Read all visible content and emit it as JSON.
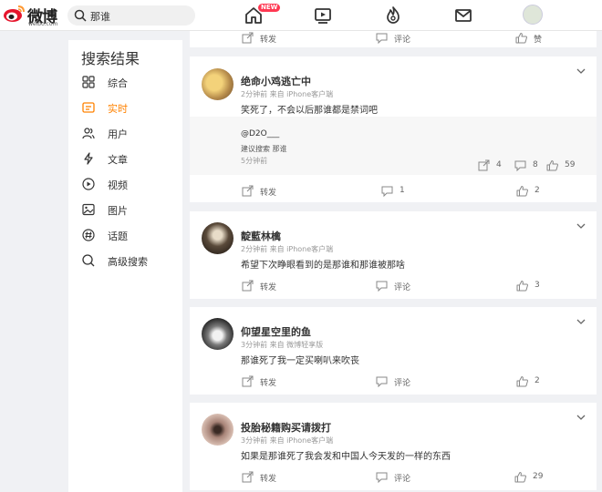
{
  "header": {
    "logo_word": "微博",
    "logo_url": "weibo.com",
    "search_query": "那谁",
    "new_badge": "NEW"
  },
  "sidebar": {
    "title": "搜索结果",
    "items": [
      {
        "label": "综合",
        "icon": "grid-icon"
      },
      {
        "label": "实时",
        "icon": "realtime-icon",
        "active": true
      },
      {
        "label": "用户",
        "icon": "users-icon"
      },
      {
        "label": "文章",
        "icon": "article-icon"
      },
      {
        "label": "视频",
        "icon": "video-icon"
      },
      {
        "label": "图片",
        "icon": "image-icon"
      },
      {
        "label": "话题",
        "icon": "topic-icon"
      },
      {
        "label": "高级搜索",
        "icon": "search-icon"
      }
    ]
  },
  "top_strip": {
    "repost": "转发",
    "comment": "评论",
    "like": "赞"
  },
  "posts": [
    {
      "username": "绝命小鸡逃亡中",
      "meta": "2分钟前  来自 iPhone客户端",
      "text": "笑死了，不会以后那谁都是禁词吧",
      "quote": {
        "handle": "@D2O___",
        "text": "建议搜索 那谁",
        "meta": "5分钟前",
        "reposts": "4",
        "comments": "8",
        "likes": "59"
      },
      "repost": "转发",
      "comment": "1",
      "like": "2"
    },
    {
      "username": "靛藍林檎",
      "meta": "2分钟前  来自 iPhone客户端",
      "text": "希望下次睁眼看到的是那谁和那谁被那啥",
      "repost": "转发",
      "comment": "评论",
      "like": "3"
    },
    {
      "username": "仰望星空里的鱼",
      "meta": "3分钟前  来自 微博轻享版",
      "text": "那谁死了我一定买喇叭来吹丧",
      "repost": "转发",
      "comment": "评论",
      "like": "2"
    },
    {
      "username": "投胎秘籍购买请拨打",
      "meta": "3分钟前  来自 iPhone客户端",
      "text": "如果是那谁死了我会发和中国人今天发的一样的东西",
      "repost": "转发",
      "comment": "评论",
      "like": "29"
    }
  ],
  "colors": {
    "accent": "#ff8200",
    "badge": "#ff3852"
  }
}
